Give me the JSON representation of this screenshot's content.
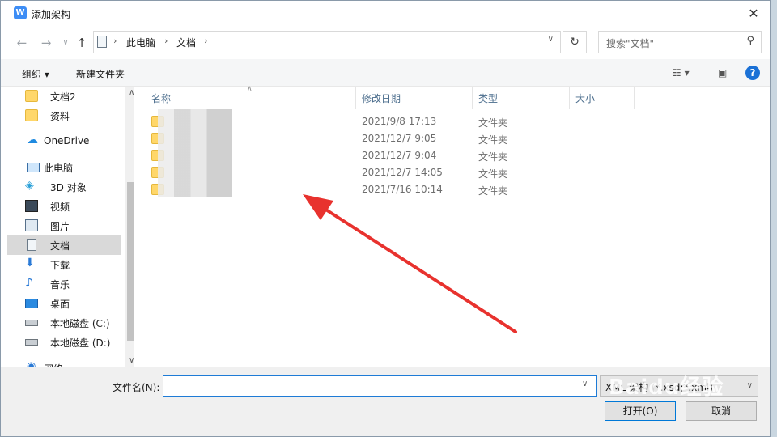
{
  "window": {
    "title": "添加架构",
    "app_icon": "W",
    "close": "✕"
  },
  "address": {
    "crumbs": [
      "此电脑",
      "文档"
    ],
    "search_placeholder": "搜索\"文档\""
  },
  "command_bar": {
    "organize": "组织 ▾",
    "new_folder": "新建文件夹"
  },
  "nav_pane": {
    "items": [
      {
        "label": "文档2",
        "icon": "folder-icon"
      },
      {
        "label": "资料",
        "icon": "folder-icon"
      },
      {
        "label": "OneDrive",
        "icon": "cloud-icon"
      },
      {
        "label": "此电脑",
        "icon": "computer-icon"
      },
      {
        "label": "3D 对象",
        "icon": "cube-icon"
      },
      {
        "label": "视频",
        "icon": "video-icon"
      },
      {
        "label": "图片",
        "icon": "picture-icon"
      },
      {
        "label": "文档",
        "icon": "document-icon",
        "selected": true
      },
      {
        "label": "下载",
        "icon": "download-icon"
      },
      {
        "label": "音乐",
        "icon": "music-icon"
      },
      {
        "label": "桌面",
        "icon": "desktop-icon"
      },
      {
        "label": "本地磁盘 (C:)",
        "icon": "drive-icon"
      },
      {
        "label": "本地磁盘 (D:)",
        "icon": "drive-icon"
      },
      {
        "label": "网络",
        "icon": "network-icon"
      }
    ]
  },
  "file_list": {
    "columns": [
      "名称",
      "修改日期",
      "类型",
      "大小"
    ],
    "rows": [
      {
        "date": "2021/9/8 17:13",
        "type": "文件夹"
      },
      {
        "date": "2021/12/7 9:05",
        "type": "文件夹"
      },
      {
        "date": "2021/12/7 9:04",
        "type": "文件夹"
      },
      {
        "date": "2021/12/7 14:05",
        "type": "文件夹"
      },
      {
        "date": "2021/7/16 10:14",
        "type": "文件夹"
      }
    ]
  },
  "footer": {
    "filename_label": "文件名(N):",
    "filename_value": "",
    "filter_value": "XML 架构 (*.xsd;*.xml)",
    "open_button": "打开(O)",
    "cancel_button": "取消"
  },
  "watermark": "Baidu经验",
  "colors": {
    "accent": "#0078d7",
    "annotation": "#e8322e"
  }
}
